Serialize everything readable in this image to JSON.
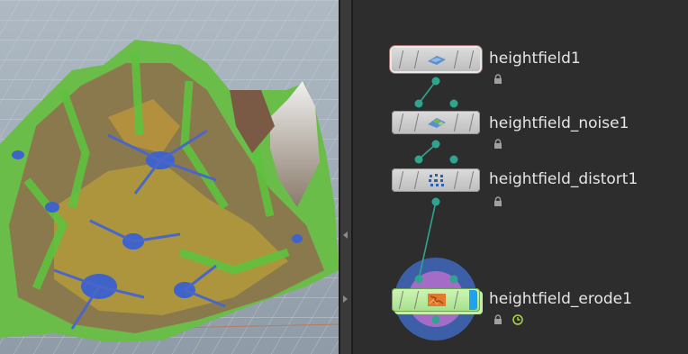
{
  "viewport": {
    "description_icon": "terrain-heightfield-viewport"
  },
  "colors": {
    "network_bg": "#2d2d2d",
    "wire": "#2fa58f",
    "node_normal": "#d0d0d0",
    "node_display": "#b5eb9a",
    "display_flag": "#1ea1ef",
    "label": "#e6e6e6"
  },
  "nodes": [
    {
      "label": "heightfield1",
      "icons": [
        "lock-icon"
      ]
    },
    {
      "label": "heightfield_noise1",
      "icons": [
        "lock-icon"
      ]
    },
    {
      "label": "heightfield_distort1",
      "icons": [
        "lock-icon"
      ]
    },
    {
      "label": "heightfield_erode1",
      "icons": [
        "lock-icon",
        "clock-icon"
      ]
    }
  ]
}
